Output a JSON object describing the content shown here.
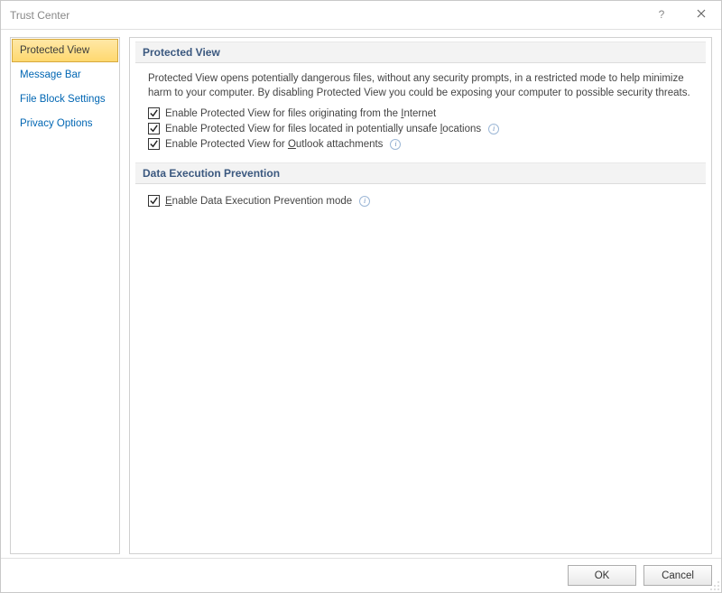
{
  "window": {
    "title": "Trust Center",
    "help_tooltip": "?",
    "close_tooltip": "✕"
  },
  "sidebar": {
    "items": [
      {
        "label": "Protected View",
        "active": true
      },
      {
        "label": "Message Bar",
        "active": false
      },
      {
        "label": "File Block Settings",
        "active": false
      },
      {
        "label": "Privacy Options",
        "active": false
      }
    ]
  },
  "sections": {
    "protected_view": {
      "header": "Protected View",
      "description": "Protected View opens potentially dangerous files, without any security prompts, in a restricted mode to help minimize harm to your computer. By disabling Protected View you could be exposing your computer to possible security threats.",
      "options": [
        {
          "checked": true,
          "pre": "Enable Protected View for files originating from the ",
          "mnemonic": "I",
          "post": "nternet",
          "info": false
        },
        {
          "checked": true,
          "pre": "Enable Protected View for files located in potentially unsafe ",
          "mnemonic": "l",
          "post": "ocations",
          "info": true
        },
        {
          "checked": true,
          "pre": "Enable Protected View for ",
          "mnemonic": "O",
          "post": "utlook attachments",
          "info": true
        }
      ]
    },
    "dep": {
      "header": "Data Execution Prevention",
      "options": [
        {
          "checked": true,
          "pre": "",
          "mnemonic": "E",
          "post": "nable Data Execution Prevention mode",
          "info": true
        }
      ]
    }
  },
  "footer": {
    "ok": "OK",
    "cancel": "Cancel"
  }
}
